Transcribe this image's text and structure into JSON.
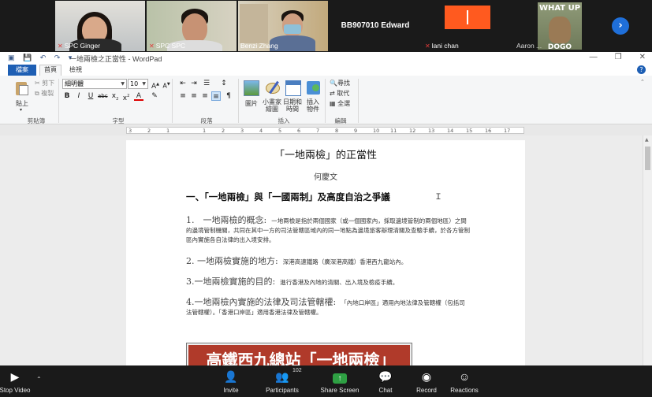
{
  "participants": [
    {
      "name": "SPC Ginger",
      "muted": true
    },
    {
      "name": "SPC SPC",
      "muted": true
    },
    {
      "name": "Benzi Zhang",
      "muted": false
    },
    {
      "name": "BB907010 Edward",
      "muted": false
    },
    {
      "name": "lani chan",
      "muted": true
    },
    {
      "name": "Aaron ...",
      "muted": false
    }
  ],
  "meme_text": "WHAT UP",
  "meme_text_bottom": "DOGO",
  "wordpad": {
    "title": "一地兩檢之正當性 - WordPad",
    "tabs": {
      "file": "檔案",
      "home": "首頁",
      "view": "檢視"
    },
    "ribbon": {
      "clipboard": {
        "paste": "貼上",
        "cut": "剪下",
        "copy": "複製",
        "label": "剪貼簿"
      },
      "font": {
        "family": "細明體",
        "size": "10",
        "label": "字型"
      },
      "paragraph": {
        "label": "段落"
      },
      "insert": {
        "picture": "圖片",
        "paint": "小畫家\n繪圖",
        "datetime": "日期和\n時間",
        "object": "插入\n物件",
        "label": "插入"
      },
      "editing": {
        "find": "尋找",
        "replace": "取代",
        "select_all": "全選",
        "label": "編輯"
      }
    },
    "ruler_marks": [
      "3",
      "2",
      "1",
      "1",
      "2",
      "3",
      "4",
      "5",
      "6",
      "7",
      "8",
      "9",
      "10",
      "11",
      "12",
      "13",
      "14",
      "15",
      "16",
      "17"
    ],
    "document": {
      "title": "「一地兩檢」的正當性",
      "author": "何慶文",
      "heading": "一、「一地兩檢」與「一國兩制」及高度自治之爭議",
      "items": [
        {
          "head": "1.　一地兩檢的概念:",
          "body": "一地兩檢是指於兩個國家（或一個國家內，採取邊境管制的兩個地區）之間的邊境管制機關，共同在其中一方的司法管轄區域內的同一地點為邊境旅客辦理清關及查驗手續，於各方管制區內實施各自法律的出入境安排。"
        },
        {
          "head": "2. 一地兩檢實施的地方:",
          "body": "深港高速鐵路（廣深港高鐵）香港西九龍站內。"
        },
        {
          "head": "3.一地兩檢實施的目的:",
          "body": "進行香港及內地的清關、出入境及檢疫手續。"
        },
        {
          "head": "4.一地兩檢內實施的法律及司法管轄權:",
          "body": "「內地口岸區」適用內地法律及管轄權（包括司法管轄權）。「香港口岸區」適用香港法律及管轄權。"
        }
      ],
      "banner_text": "高鐵西九總站「一地兩檢」"
    }
  },
  "toolbar": {
    "stop_video": "Stop Video",
    "invite": "Invite",
    "participants": "Participants",
    "participant_count": "102",
    "share_screen": "Share Screen",
    "chat": "Chat",
    "record": "Record",
    "reactions": "Reactions"
  }
}
